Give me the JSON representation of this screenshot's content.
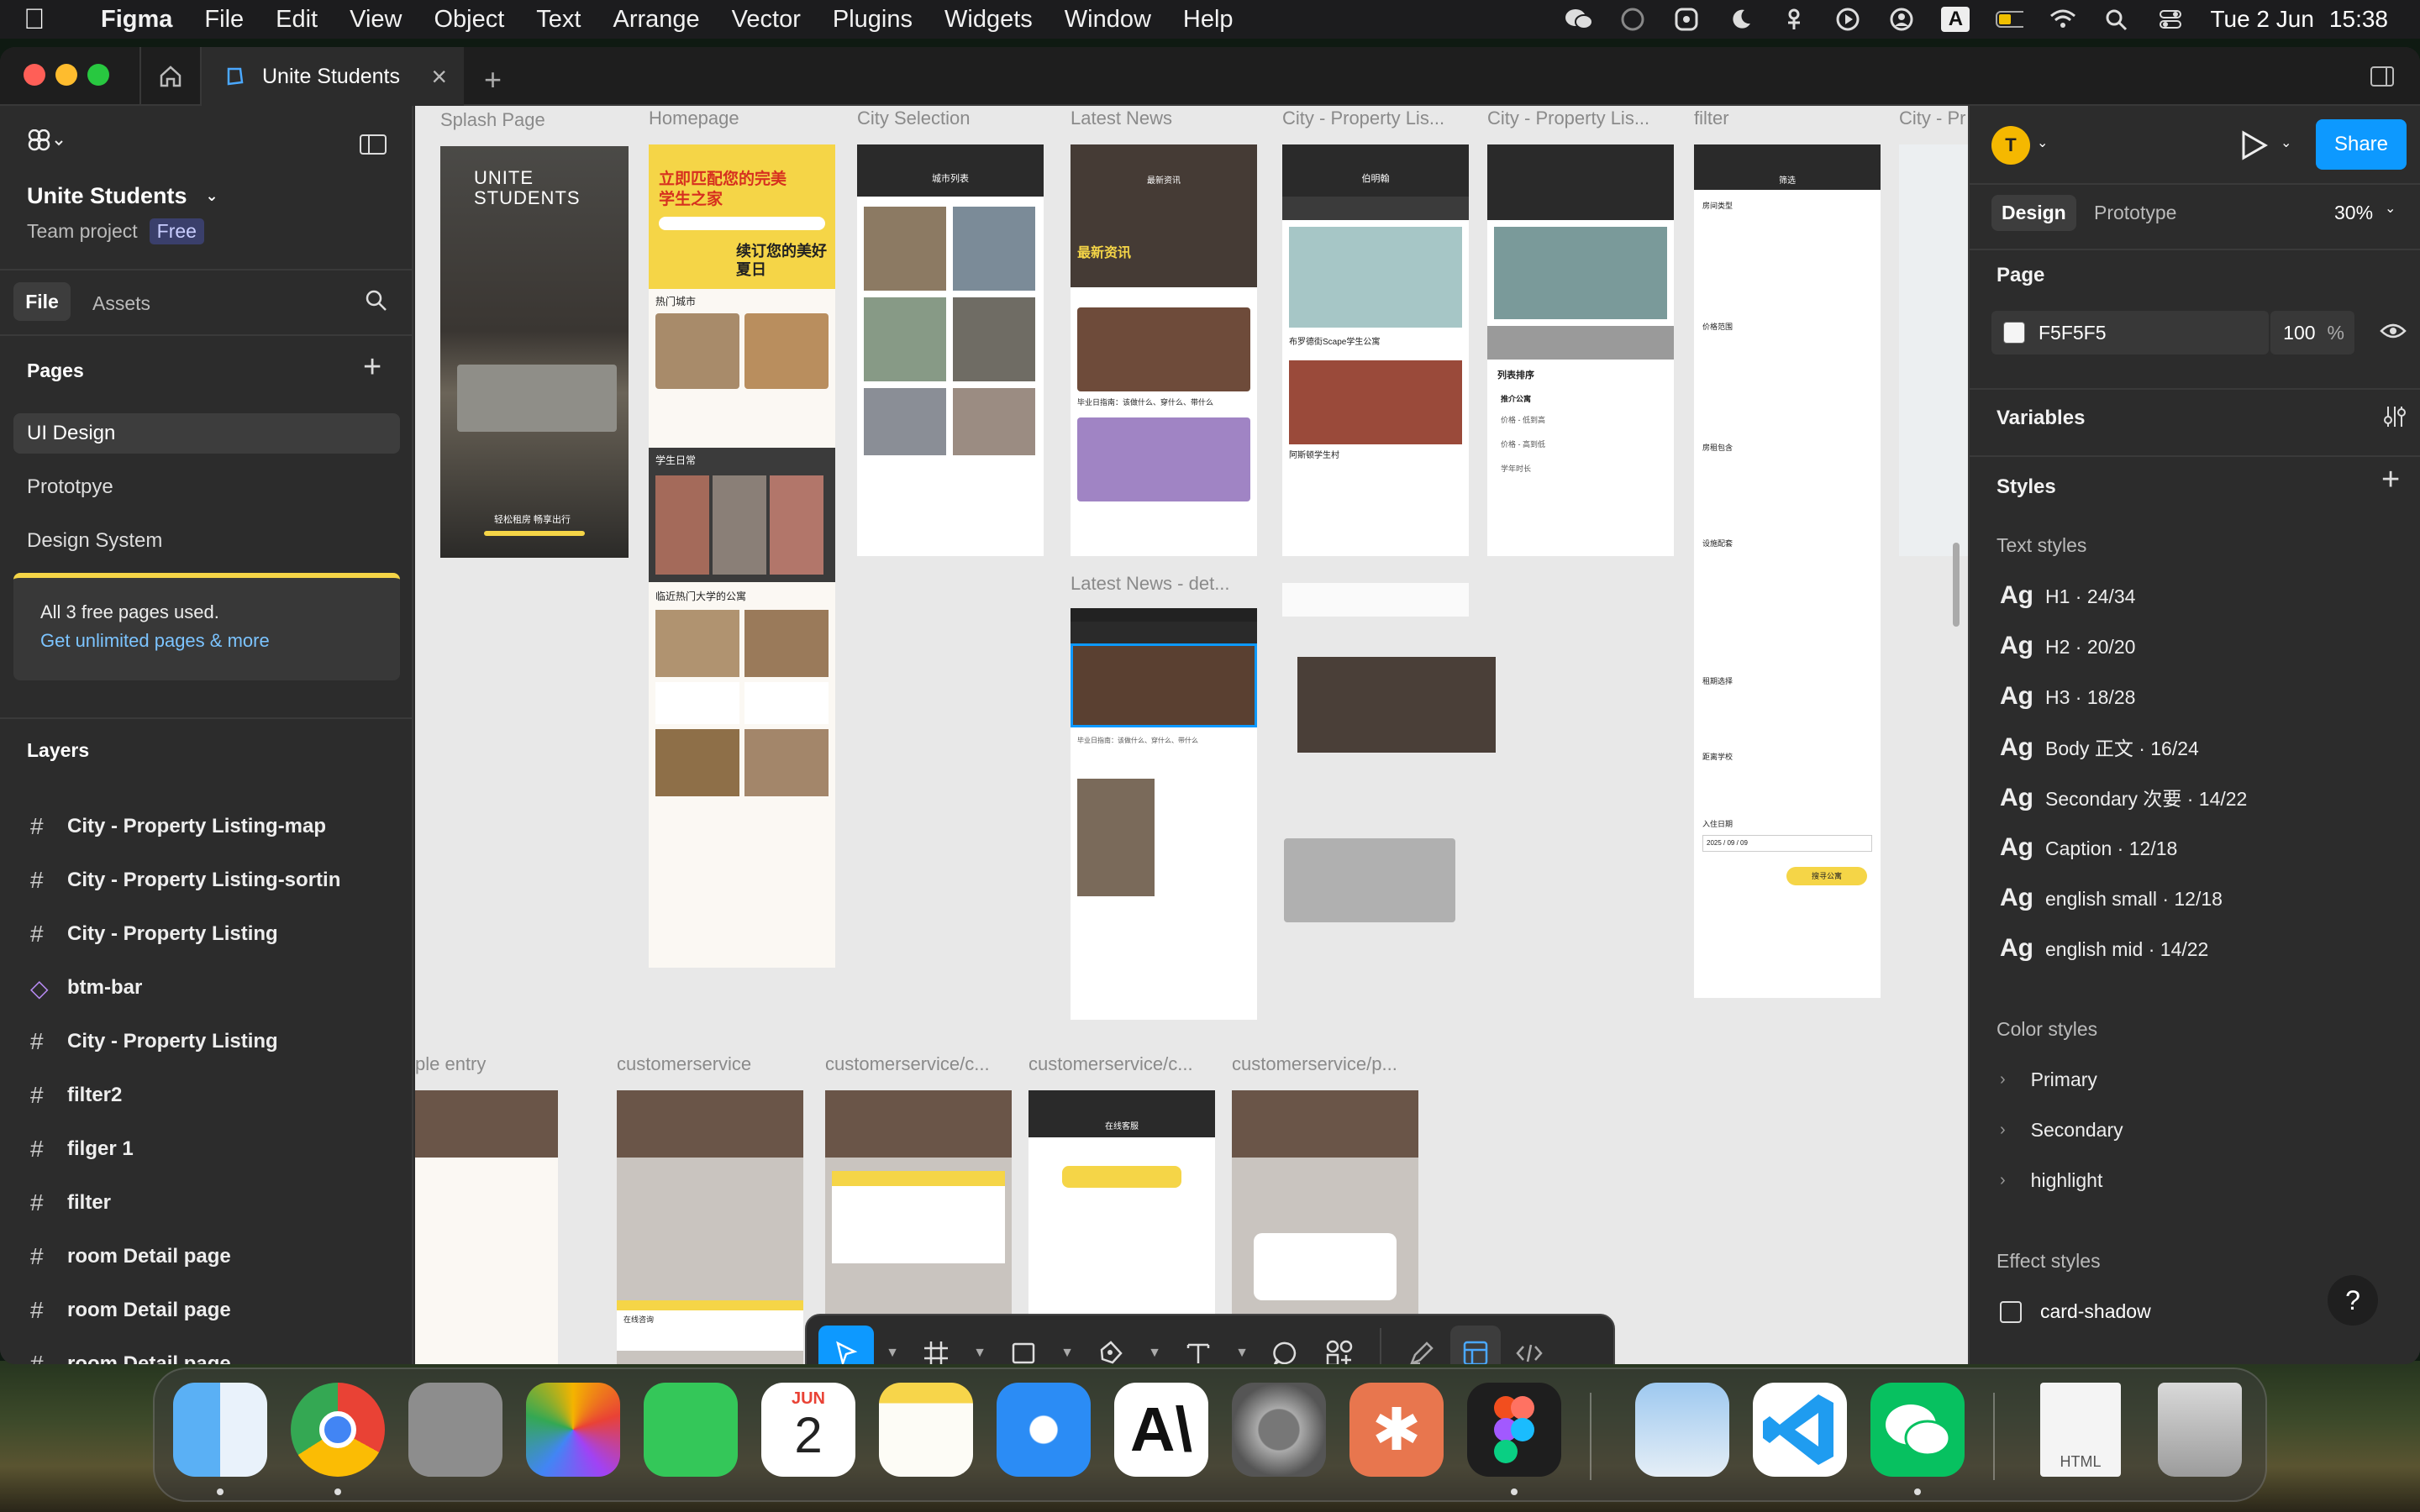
{
  "menubar": {
    "app_name": "Figma",
    "items": [
      "File",
      "Edit",
      "View",
      "Object",
      "Text",
      "Arrange",
      "Vector",
      "Plugins",
      "Widgets",
      "Window",
      "Help"
    ],
    "date": "Tue 2 Jun",
    "time": "15:38",
    "input_source": "A"
  },
  "window": {
    "tab_title": "Unite Students"
  },
  "left_panel": {
    "project_name": "Unite Students",
    "team_label": "Team project",
    "plan_badge": "Free",
    "tabs": [
      "File",
      "Assets"
    ],
    "pages_heading": "Pages",
    "pages": [
      "UI Design",
      "Prototpye",
      "Design System"
    ],
    "upgrade_text": "All 3 free pages used.",
    "upgrade_link": "Get unlimited pages & more",
    "layers_heading": "Layers",
    "layers": [
      {
        "name": "City - Property Listing-map",
        "icon": "frame-icon"
      },
      {
        "name": "City - Property Listing-sortin",
        "icon": "frame-icon"
      },
      {
        "name": "City - Property Listing",
        "icon": "frame-icon"
      },
      {
        "name": "btm-bar",
        "icon": "component-icon"
      },
      {
        "name": "City - Property Listing",
        "icon": "frame-icon"
      },
      {
        "name": "filter2",
        "icon": "frame-icon"
      },
      {
        "name": "filger 1",
        "icon": "frame-icon"
      },
      {
        "name": "filter",
        "icon": "frame-icon"
      },
      {
        "name": "room Detail page",
        "icon": "frame-icon"
      },
      {
        "name": "room Detail page",
        "icon": "frame-icon"
      },
      {
        "name": "room Detail page",
        "icon": "frame-icon"
      }
    ]
  },
  "canvas": {
    "frame_labels": [
      "Splash Page",
      "Homepage",
      "City Selection",
      "Latest News",
      "City - Property Lis...",
      "City - Property Lis...",
      "filter",
      "City - Pr",
      "Latest News - det...",
      "ple entry",
      "customerservice",
      "customerservice/c...",
      "customerservice/c...",
      "customerservice/p..."
    ],
    "splash_logo": "UNITE STUDENTS",
    "splash_caption": "轻松租房  畅享出行",
    "homepage_banner": "立即匹配您的完美学生之家",
    "homepage_promo": "续订您的美好夏日",
    "homepage_section_1": "热门城市",
    "homepage_section_2": "学生日常",
    "homepage_section_3": "临近热门大学的公寓",
    "city_header": "城市列表",
    "news_header": "最新资讯",
    "news_banner": "最新资讯",
    "news_caption": "毕业日指南：该做什么、穿什么、带什么",
    "property_header": "伯明翰",
    "property_title": "布罗德街Scape学生公寓",
    "property_title_2": "阿斯顿学生村",
    "sort_title": "列表排序",
    "sort_option_1": "推介公寓",
    "sort_option_2": "价格 - 低到高",
    "sort_option_3": "价格 - 高到低",
    "sort_option_4": "学年时长",
    "filter_header": "筛选",
    "filter_section_1": "房间类型",
    "filter_section_2": "价格范围",
    "filter_section_3": "房租包含",
    "filter_section_4": "设施配套",
    "filter_section_5": "租期选择",
    "filter_section_6": "距离学校",
    "filter_section_7": "入住日期",
    "filter_date": "2025 / 09 / 09",
    "filter_button": "搜寻公寓",
    "service_header": "在线客服",
    "service_card": "在线咨询"
  },
  "right_panel": {
    "user_initial": "T",
    "share_label": "Share",
    "tabs": [
      "Design",
      "Prototype"
    ],
    "zoom": "30%",
    "page_heading": "Page",
    "page_color": "F5F5F5",
    "page_color_swatch": "#F5F5F5",
    "page_opacity": "100",
    "percent_sign": "%",
    "variables_heading": "Variables",
    "styles_heading": "Styles",
    "text_styles_heading": "Text styles",
    "text_styles": [
      {
        "sample": "Ag",
        "name": "H1 · 24/34"
      },
      {
        "sample": "Ag",
        "name": "H2 · 20/20"
      },
      {
        "sample": "Ag",
        "name": "H3 · 18/28"
      },
      {
        "sample": "Ag",
        "name": "Body 正文 · 16/24"
      },
      {
        "sample": "Ag",
        "name": "Secondary 次要 · 14/22"
      },
      {
        "sample": "Ag",
        "name": "Caption · 12/18"
      },
      {
        "sample": "Ag",
        "name": "english small · 12/18"
      },
      {
        "sample": "Ag",
        "name": "english mid · 14/22"
      }
    ],
    "color_styles_heading": "Color styles",
    "color_styles": [
      "Primary",
      "Secondary",
      "highlight"
    ],
    "effect_styles_heading": "Effect styles",
    "effect_styles": [
      "card-shadow"
    ],
    "help_label": "?"
  },
  "colors": {
    "accent_blue": "#0d99ff",
    "brand_yellow": "#f5d547",
    "canvas_bg": "#e8e8e8",
    "panel_bg": "#2c2c2c"
  },
  "dock": {
    "apps": [
      "Finder",
      "Chrome",
      "Launchpad",
      "Photos",
      "FaceTime",
      "Calendar",
      "Notes",
      "Safari",
      "Anthropic",
      "System Settings",
      "Claude",
      "Figma",
      "Preview",
      "VS Code",
      "WeChat",
      "HTML file",
      "Trash"
    ],
    "calendar_month": "JUN",
    "calendar_day": "2",
    "html_file_label": "HTML"
  }
}
